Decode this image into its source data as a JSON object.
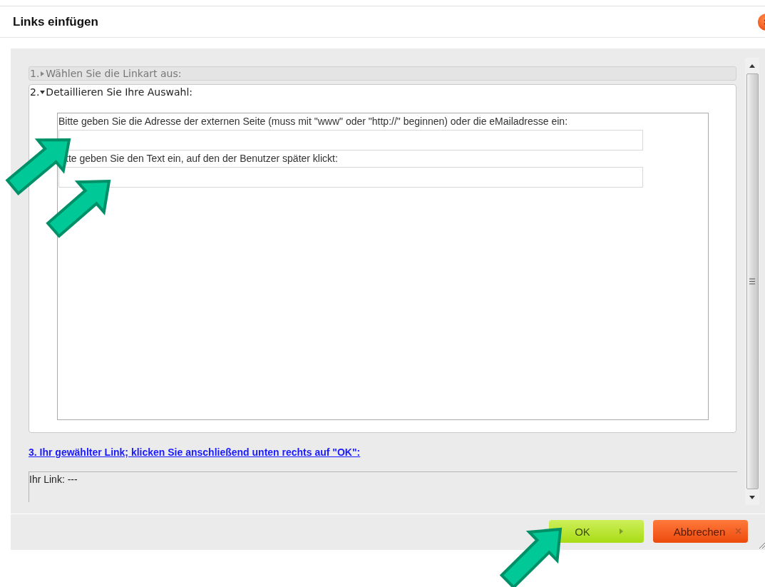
{
  "dialog": {
    "title": "Links einfügen"
  },
  "steps": [
    {
      "number": "1.",
      "label": "Wählen Sie die Linkart aus:",
      "expanded": false
    },
    {
      "number": "2.",
      "label": "Detaillieren Sie Ihre Auswahl:",
      "expanded": true
    }
  ],
  "fields": [
    {
      "label": "Bitte geben Sie die Adresse der externen Seite (muss mit \"www\" oder \"http://\" beginnen) oder die eMailadresse ein:"
    },
    {
      "label": "tte geben Sie den Text ein, auf den der Benutzer später klickt:"
    }
  ],
  "link_heading": "3. Ihr gewählter Link; klicken Sie anschließend unten rechts auf \"OK\":",
  "link_preview": "Ihr Link: ---",
  "buttons": [
    {
      "label": "OK",
      "kind": "confirm"
    },
    {
      "label": "Abbrechen",
      "kind": "cancel"
    }
  ]
}
